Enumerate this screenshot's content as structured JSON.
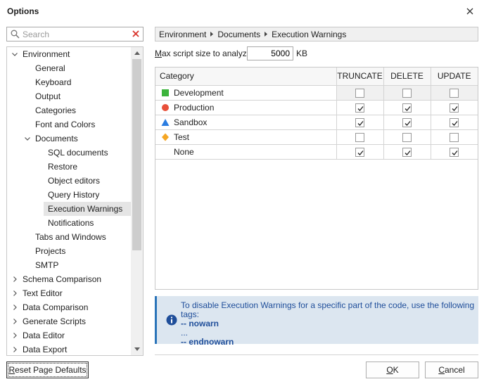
{
  "window": {
    "title": "Options",
    "close_icon": "close-icon"
  },
  "search": {
    "placeholder": "Search",
    "value": ""
  },
  "tree": {
    "items": [
      {
        "label": "Environment",
        "level": 0,
        "expanded": true
      },
      {
        "label": "General",
        "level": 1
      },
      {
        "label": "Keyboard",
        "level": 1
      },
      {
        "label": "Output",
        "level": 1
      },
      {
        "label": "Categories",
        "level": 1
      },
      {
        "label": "Font and Colors",
        "level": 1
      },
      {
        "label": "Documents",
        "level": 1,
        "expanded": true
      },
      {
        "label": "SQL documents",
        "level": 2
      },
      {
        "label": "Restore",
        "level": 2
      },
      {
        "label": "Object editors",
        "level": 2
      },
      {
        "label": "Query History",
        "level": 2
      },
      {
        "label": "Execution Warnings",
        "level": 2,
        "selected": true
      },
      {
        "label": "Notifications",
        "level": 2
      },
      {
        "label": "Tabs and Windows",
        "level": 1
      },
      {
        "label": "Projects",
        "level": 1
      },
      {
        "label": "SMTP",
        "level": 1
      },
      {
        "label": "Schema Comparison",
        "level": 0,
        "expanded": false
      },
      {
        "label": "Text Editor",
        "level": 0,
        "expanded": false
      },
      {
        "label": "Data Comparison",
        "level": 0,
        "expanded": false
      },
      {
        "label": "Generate Scripts",
        "level": 0,
        "expanded": false
      },
      {
        "label": "Data Editor",
        "level": 0,
        "expanded": false
      },
      {
        "label": "Data Export",
        "level": 0,
        "expanded": false
      }
    ]
  },
  "breadcrumb": [
    "Environment",
    "Documents",
    "Execution Warnings"
  ],
  "max_script": {
    "label_prefix": "M",
    "label_rest": "ax script size to analyze:",
    "value": "5000",
    "unit": "KB"
  },
  "grid": {
    "columns": [
      "Category",
      "TRUNCATE",
      "DELETE",
      "UPDATE"
    ],
    "rows": [
      {
        "name": "Development",
        "icon": "green-square-icon",
        "color": "#3cb43c",
        "truncate": false,
        "delete": false,
        "update": false,
        "selected": true
      },
      {
        "name": "Production",
        "icon": "red-circle-icon",
        "color": "#e8503a",
        "truncate": true,
        "delete": true,
        "update": true
      },
      {
        "name": "Sandbox",
        "icon": "blue-triangle-icon",
        "color": "#2b7de1",
        "truncate": true,
        "delete": true,
        "update": true
      },
      {
        "name": "Test",
        "icon": "orange-diamond-icon",
        "color": "#f5a623",
        "truncate": false,
        "delete": false,
        "update": false
      },
      {
        "name": "None",
        "icon": "",
        "color": "",
        "truncate": true,
        "delete": true,
        "update": true
      }
    ]
  },
  "info": {
    "line1": "To disable Execution Warnings for a specific part of the code, use the following tags:",
    "line2": "-- nowarn",
    "line3": "...",
    "line4": "-- endnowarn"
  },
  "buttons": {
    "reset": {
      "pre": "R",
      "rest": "eset Page Defaults"
    },
    "ok": {
      "pre": "O",
      "rest": "K"
    },
    "cancel": {
      "pre": "C",
      "rest": "ancel"
    }
  },
  "colors": {
    "accent": "#2a74b9",
    "info_bg": "#dce6f0",
    "info_text": "#1f4e9a"
  }
}
